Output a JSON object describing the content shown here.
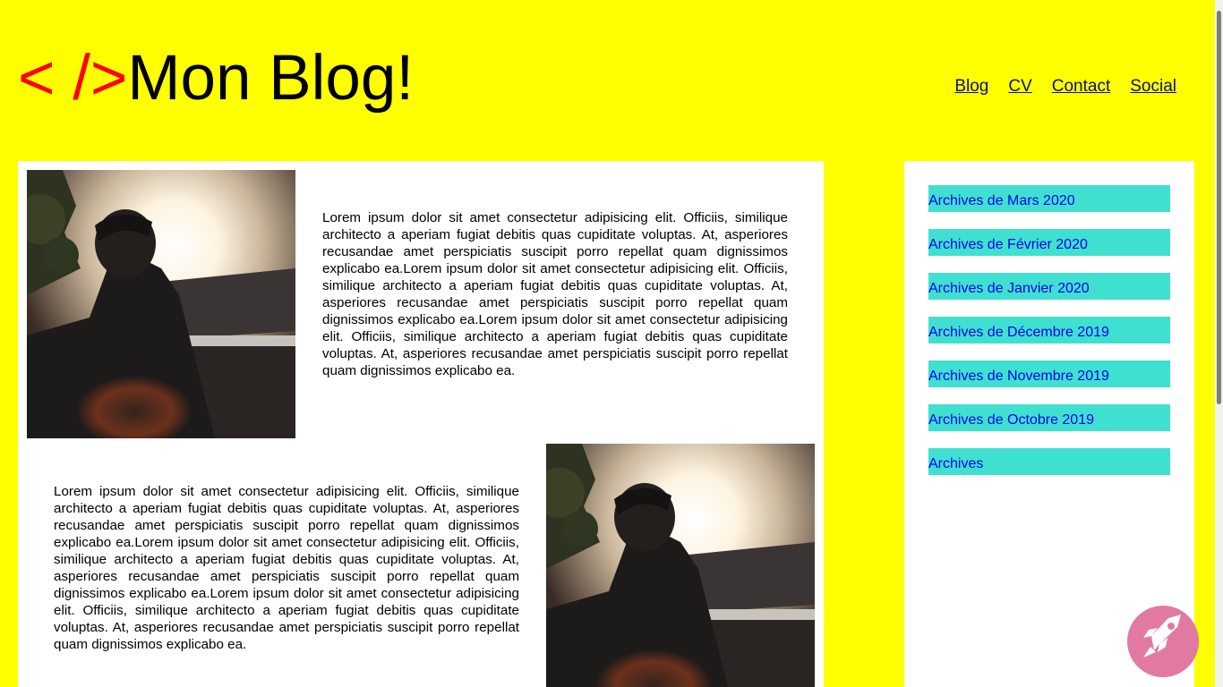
{
  "header": {
    "logo_code": "< />",
    "logo_text": "Mon Blog!"
  },
  "nav": {
    "items": [
      "Blog",
      "CV",
      "Contact",
      "Social"
    ]
  },
  "posts": [
    {
      "text": "Lorem ipsum dolor sit amet consectetur adipisicing elit. Officiis, similique architecto a aperiam fugiat debitis quas cupiditate voluptas. At, asperiores recusandae amet perspiciatis suscipit porro repellat quam dignissimos explicabo ea.Lorem ipsum dolor sit amet consectetur adipisicing elit. Officiis, similique architecto a aperiam fugiat debitis quas cupiditate voluptas. At, asperiores recusandae amet perspiciatis suscipit porro repellat quam dignissimos explicabo ea.Lorem ipsum dolor sit amet consectetur adipisicing elit. Officiis, similique architecto a aperiam fugiat debitis quas cupiditate voluptas. At, asperiores recusandae amet perspiciatis suscipit porro repellat quam dignissimos explicabo ea."
    },
    {
      "text": "Lorem ipsum dolor sit amet consectetur adipisicing elit. Officiis, similique architecto a aperiam fugiat debitis quas cupiditate voluptas. At, asperiores recusandae amet perspiciatis suscipit porro repellat quam dignissimos explicabo ea.Lorem ipsum dolor sit amet consectetur adipisicing elit. Officiis, similique architecto a aperiam fugiat debitis quas cupiditate voluptas. At, asperiores recusandae amet perspiciatis suscipit porro repellat quam dignissimos explicabo ea.Lorem ipsum dolor sit amet consectetur adipisicing elit. Officiis, similique architecto a aperiam fugiat debitis quas cupiditate voluptas. At, asperiores recusandae amet perspiciatis suscipit porro repellat quam dignissimos explicabo ea."
    }
  ],
  "sidebar": {
    "archives": [
      "Archives de Mars 2020",
      "Archives de Février 2020",
      "Archives de Janvier 2020",
      "Archives de Décembre 2019",
      "Archives de Novembre 2019",
      "Archives de Octobre 2019",
      "Archives"
    ]
  },
  "colors": {
    "page_background": "#ffff00",
    "logo_code": "#ff0000",
    "archive_item_background": "#40e0d0",
    "link": "#0000ee",
    "fab": "#e17aa3"
  },
  "icons": {
    "fab": "rocket-icon"
  }
}
